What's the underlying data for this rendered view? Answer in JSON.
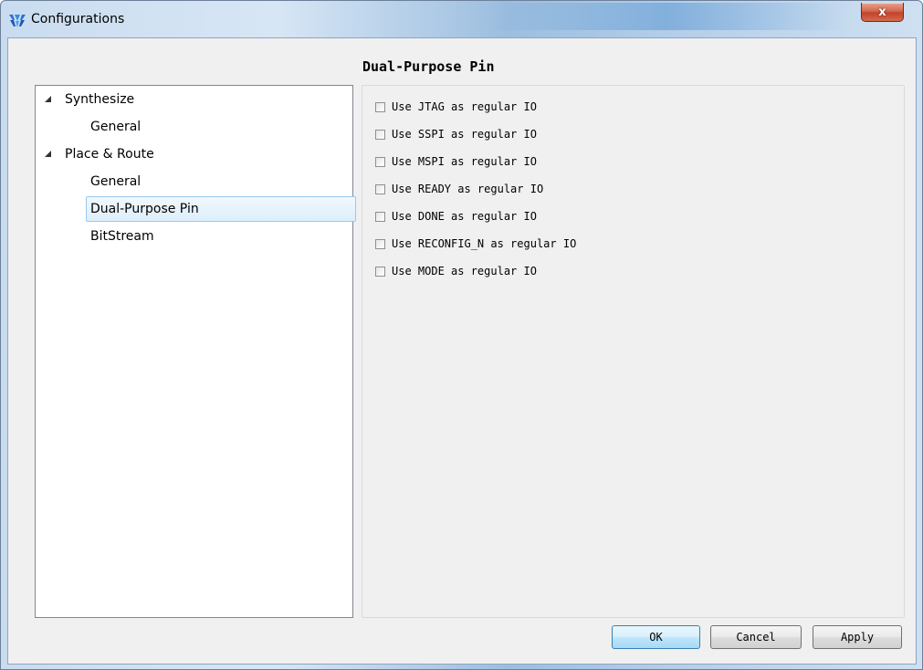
{
  "window": {
    "title": "Configurations",
    "close_label": "x"
  },
  "page": {
    "title": "Dual-Purpose Pin"
  },
  "tree": {
    "items": [
      {
        "label": "Synthesize",
        "level": 0,
        "expanded": true
      },
      {
        "label": "General",
        "level": 1
      },
      {
        "label": "Place & Route",
        "level": 0,
        "expanded": true
      },
      {
        "label": "General",
        "level": 1
      },
      {
        "label": "Dual-Purpose Pin",
        "level": 1,
        "selected": true
      },
      {
        "label": "BitStream",
        "level": 1
      }
    ]
  },
  "options": [
    {
      "label": "Use JTAG as regular IO",
      "checked": false
    },
    {
      "label": "Use SSPI as regular IO",
      "checked": false
    },
    {
      "label": "Use MSPI as regular IO",
      "checked": false
    },
    {
      "label": "Use READY as regular IO",
      "checked": false
    },
    {
      "label": "Use DONE as regular IO",
      "checked": false
    },
    {
      "label": "Use RECONFIG_N as regular IO",
      "checked": false
    },
    {
      "label": "Use MODE as regular IO",
      "checked": false
    }
  ],
  "buttons": {
    "ok": "OK",
    "cancel": "Cancel",
    "apply": "Apply"
  },
  "colors": {
    "selection_border": "#9ac8ef",
    "default_button": "#bee6fd",
    "close_button": "#c2432b"
  }
}
